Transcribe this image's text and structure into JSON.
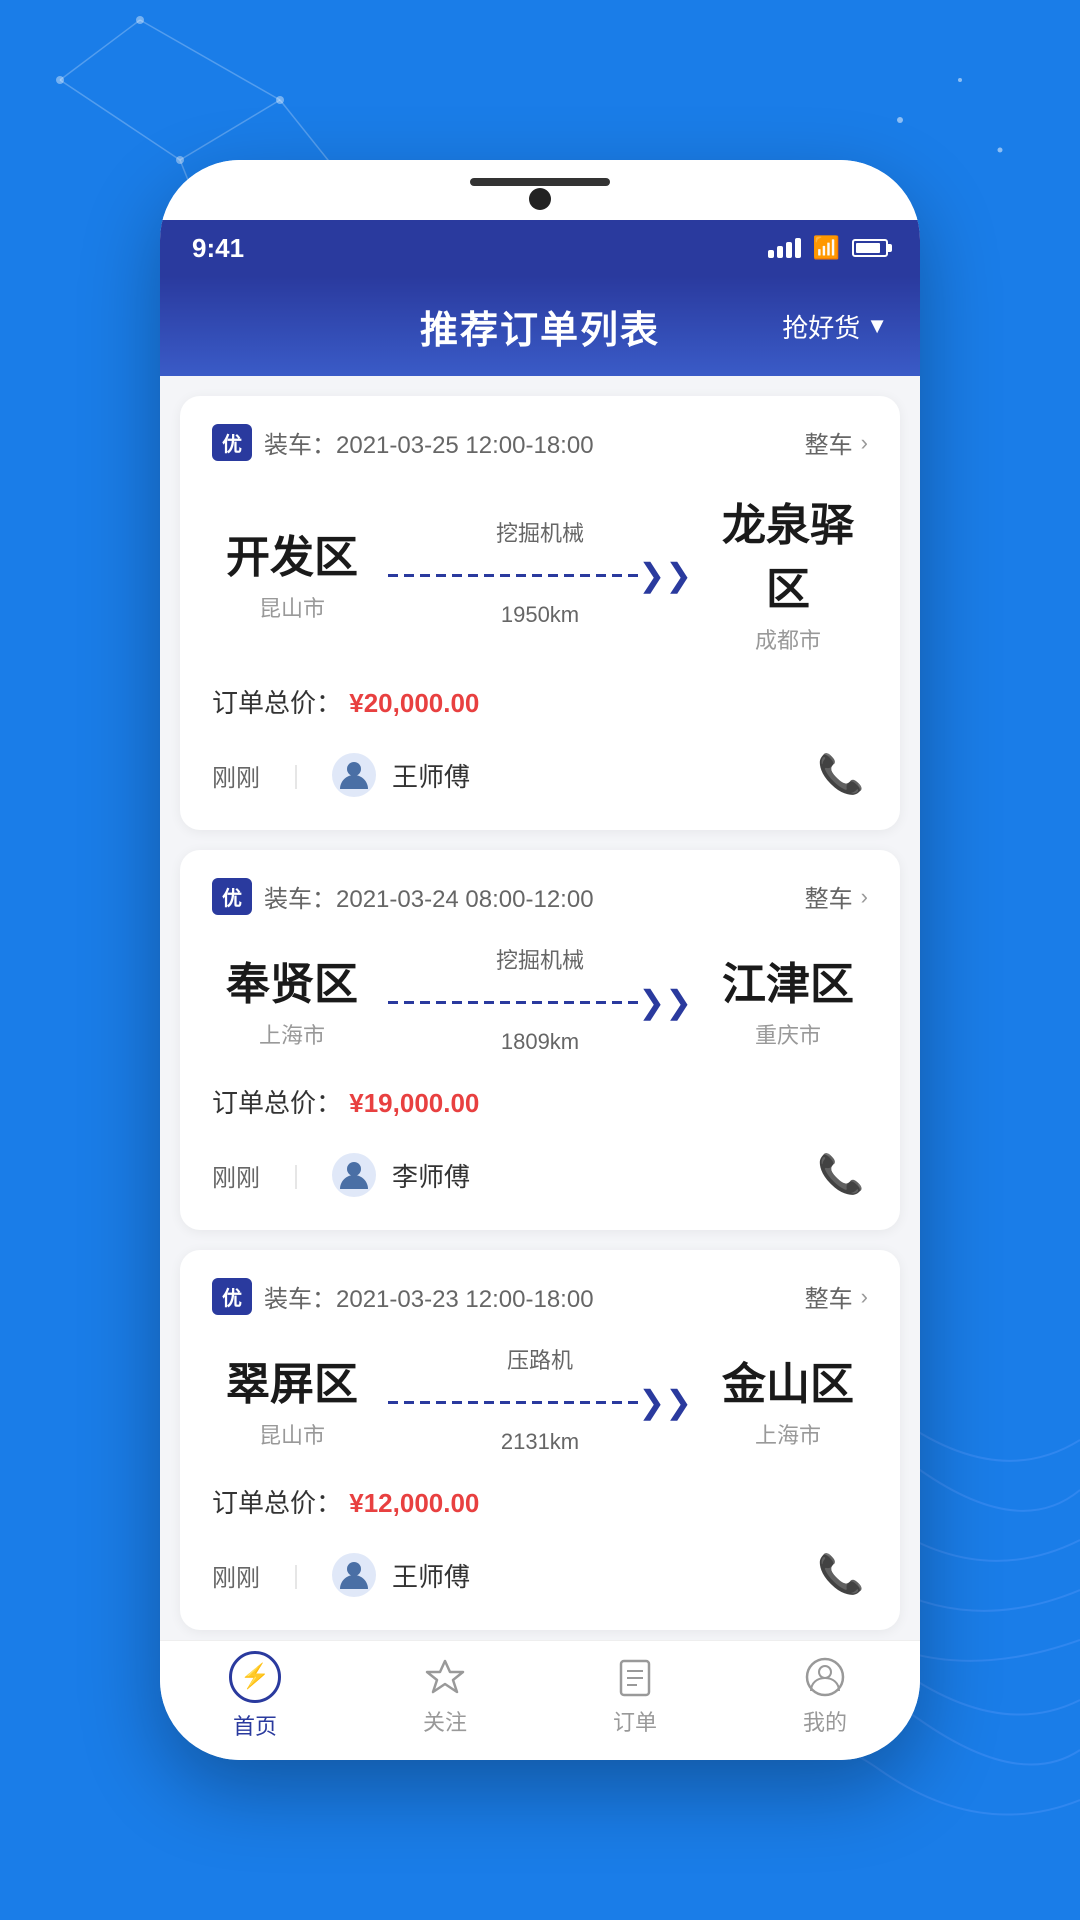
{
  "background": {
    "color": "#1a7de8"
  },
  "status_bar": {
    "time": "9:41",
    "signal": "signal",
    "wifi": "wifi",
    "battery": "battery"
  },
  "header": {
    "title": "推荐订单列表",
    "action_label": "抢好货"
  },
  "orders": [
    {
      "id": "order-1",
      "badge": "优",
      "load_time": "装车：2021-03-25 12:00-18:00",
      "type_label": "整车",
      "from_name": "开发区",
      "from_city": "昆山市",
      "to_name": "龙泉驿区",
      "to_city": "成都市",
      "cargo_type": "挖掘机械",
      "distance": "1950km",
      "price_label": "订单总价：",
      "price": "¥20,000.00",
      "time_ago": "刚刚",
      "driver_name": "王师傅"
    },
    {
      "id": "order-2",
      "badge": "优",
      "load_time": "装车：2021-03-24 08:00-12:00",
      "type_label": "整车",
      "from_name": "奉贤区",
      "from_city": "上海市",
      "to_name": "江津区",
      "to_city": "重庆市",
      "cargo_type": "挖掘机械",
      "distance": "1809km",
      "price_label": "订单总价：",
      "price": "¥19,000.00",
      "time_ago": "刚刚",
      "driver_name": "李师傅"
    },
    {
      "id": "order-3",
      "badge": "优",
      "load_time": "装车：2021-03-23 12:00-18:00",
      "type_label": "整车",
      "from_name": "翠屏区",
      "from_city": "昆山市",
      "to_name": "金山区",
      "to_city": "上海市",
      "cargo_type": "压路机",
      "distance": "2131km",
      "price_label": "订单总价：",
      "price": "¥12,000.00",
      "time_ago": "刚刚",
      "driver_name": "王师傅"
    }
  ],
  "bottom_nav": {
    "items": [
      {
        "label": "首页",
        "icon": "home",
        "active": true
      },
      {
        "label": "关注",
        "icon": "star",
        "active": false
      },
      {
        "label": "订单",
        "icon": "list",
        "active": false
      },
      {
        "label": "我的",
        "icon": "user",
        "active": false
      }
    ]
  }
}
